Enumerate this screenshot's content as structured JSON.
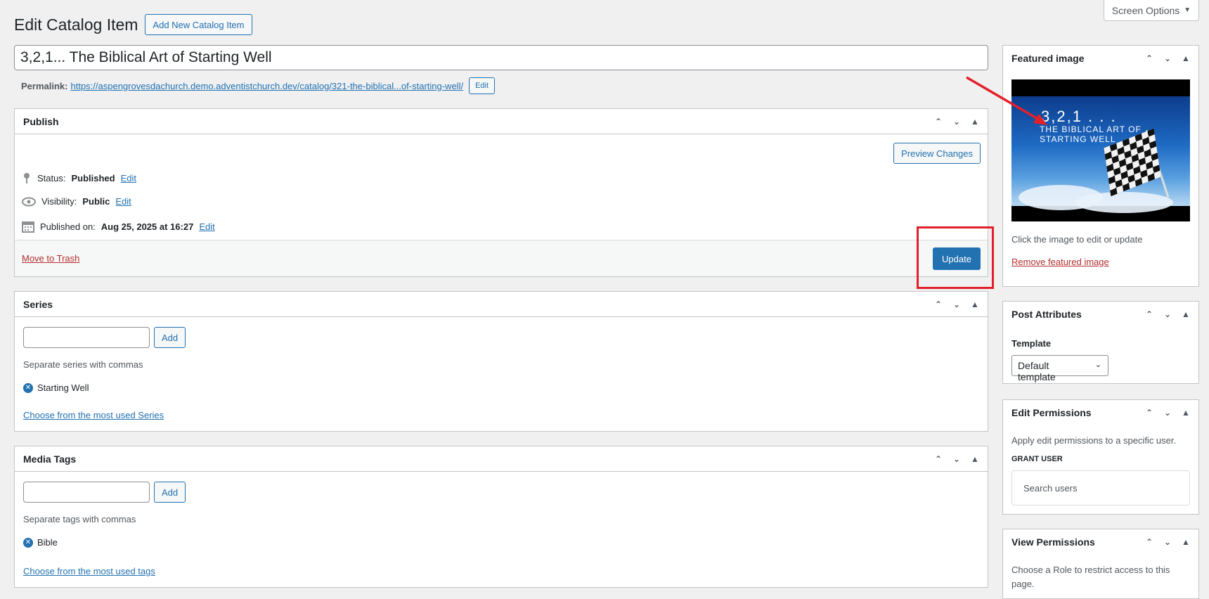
{
  "screen_options": {
    "label": "Screen Options",
    "icon": "triangle-down-icon"
  },
  "header": {
    "title": "Edit Catalog Item",
    "add_new_label": "Add New Catalog Item"
  },
  "title_field": {
    "value": "3,2,1... The Biblical Art of Starting Well"
  },
  "permalink": {
    "label": "Permalink:",
    "url": "https://aspengrovesdachurch.demo.adventistchurch.dev/catalog/321-the-biblical...of-starting-well/",
    "edit_label": "Edit"
  },
  "publish": {
    "title": "Publish",
    "preview_label": "Preview Changes",
    "status_label": "Status:",
    "status_value": "Published",
    "visibility_label": "Visibility:",
    "visibility_value": "Public",
    "published_label": "Published on:",
    "published_value": "Aug 25, 2025 at 16:27",
    "edit_label": "Edit",
    "trash_label": "Move to Trash",
    "update_label": "Update"
  },
  "series": {
    "title": "Series",
    "add_label": "Add",
    "hint": "Separate series with commas",
    "tags": [
      "Starting Well"
    ],
    "choose_label": "Choose from the most used Series"
  },
  "media_tags": {
    "title": "Media Tags",
    "add_label": "Add",
    "hint": "Separate tags with commas",
    "tags": [
      "Bible"
    ],
    "choose_label": "Choose from the most used tags"
  },
  "featured_image": {
    "title": "Featured image",
    "image_title_line1": "3,2,1 . . .",
    "image_title_line2": "THE BIBLICAL ART OF",
    "image_title_line3": "STARTING WELL",
    "hint": "Click the image to edit or update",
    "remove_label": "Remove featured image"
  },
  "post_attributes": {
    "title": "Post Attributes",
    "template_label": "Template",
    "template_value": "Default template"
  },
  "edit_permissions": {
    "title": "Edit Permissions",
    "description": "Apply edit permissions to a specific user.",
    "grant_label": "GRANT USER",
    "search_placeholder": "Search users"
  },
  "view_permissions": {
    "title": "View Permissions",
    "description": "Choose a Role to restrict access to this page."
  },
  "colors": {
    "accent": "#2271b1",
    "danger": "#b32d2e",
    "highlight": "#e2202a"
  }
}
